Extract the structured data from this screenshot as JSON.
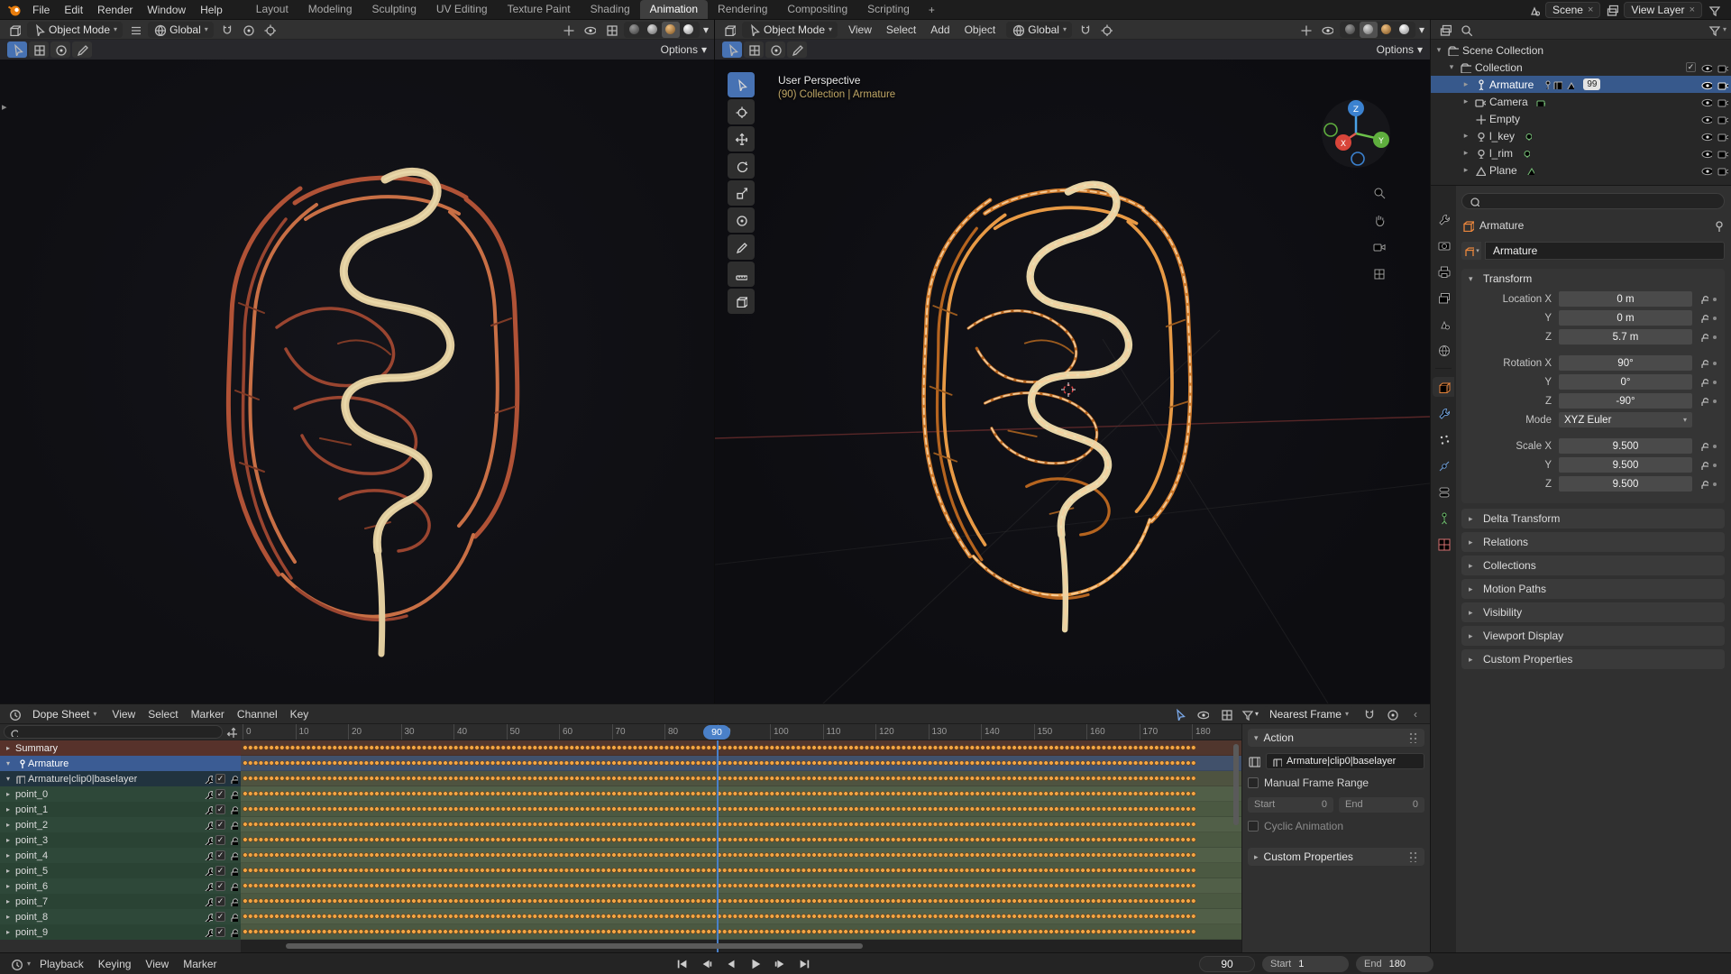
{
  "icons": {
    "blender-logo": "orange-blender-mark",
    "search": "magnifier",
    "filter": "funnel",
    "snap": "magnet",
    "eye": "visibility-eye",
    "camera": "render-camera",
    "lock": "padlock",
    "checkbox": "check-box",
    "chevron": "chevron-down",
    "pin": "push-pin",
    "play": "right-triangle"
  },
  "topbar": {
    "menus": [
      "File",
      "Edit",
      "Render",
      "Window",
      "Help"
    ],
    "workspaces": [
      {
        "label": "Layout"
      },
      {
        "label": "Modeling"
      },
      {
        "label": "Sculpting"
      },
      {
        "label": "UV Editing"
      },
      {
        "label": "Texture Paint"
      },
      {
        "label": "Shading"
      },
      {
        "label": "Animation",
        "selected": true
      },
      {
        "label": "Rendering"
      },
      {
        "label": "Compositing"
      },
      {
        "label": "Scripting"
      }
    ],
    "add_workspace_label": "+",
    "scene_name": "Scene",
    "view_layer_name": "View Layer"
  },
  "viewport_left": {
    "mode": "Object Mode",
    "orientation": "Global",
    "options_label": "Options"
  },
  "viewport_right": {
    "mode": "Object Mode",
    "menus": [
      "View",
      "Select",
      "Add",
      "Object"
    ],
    "orientation": "Global",
    "options_label": "Options",
    "overlay_line1": "User Perspective",
    "overlay_line2": "(90) Collection | Armature",
    "gizmo": {
      "up": "Z",
      "left": "X",
      "right": "Y"
    },
    "tools": [
      "tweak-select",
      "cursor",
      "move",
      "rotate",
      "scale",
      "transform",
      "annotate",
      "measure",
      "add-primitive"
    ]
  },
  "outliner": {
    "root_label": "Scene Collection",
    "rows": [
      {
        "label": "Collection"
      },
      {
        "label": "Armature",
        "selected": true,
        "badge": "99"
      },
      {
        "label": "Camera"
      },
      {
        "label": "Empty"
      },
      {
        "label": "l_key"
      },
      {
        "label": "l_rim"
      },
      {
        "label": "Plane"
      }
    ]
  },
  "properties": {
    "breadcrumb": "Armature",
    "object_name": "Armature",
    "transform_title": "Transform",
    "transform_rows": [
      {
        "label": "Location X",
        "value": "0 m"
      },
      {
        "label": "Y",
        "value": "0 m"
      },
      {
        "label": "Z",
        "value": "5.7 m"
      },
      {
        "label": "Rotation X",
        "value": "90°"
      },
      {
        "label": "Y",
        "value": "0°"
      },
      {
        "label": "Z",
        "value": "-90°"
      },
      {
        "label": "Mode",
        "value": "XYZ Euler"
      },
      {
        "label": "Scale X",
        "value": "9.500"
      },
      {
        "label": "Y",
        "value": "9.500"
      },
      {
        "label": "Z",
        "value": "9.500"
      }
    ],
    "sections": [
      "Delta Transform",
      "Relations",
      "Collections",
      "Motion Paths",
      "Visibility",
      "Viewport Display",
      "Custom Properties"
    ]
  },
  "dopesheet": {
    "editor_label": "Dope Sheet",
    "menus": [
      "View",
      "Select",
      "Marker",
      "Channel",
      "Key"
    ],
    "snap_label": "Nearest Frame",
    "current_frame": "90",
    "ruler_ticks": [
      "0",
      "10",
      "20",
      "30",
      "40",
      "50",
      "60",
      "70",
      "80",
      "90",
      "100",
      "110",
      "120",
      "130",
      "140",
      "150",
      "160",
      "170",
      "180"
    ],
    "channels": [
      {
        "label": "Summary",
        "cls": "lane-summary"
      },
      {
        "label": "Armature",
        "cls": "lane-object",
        "selected": true
      },
      {
        "label": "Armature|clip0|baselayer",
        "cls": "lane-action"
      },
      {
        "label": "point_0",
        "cls": "lane-fc-a"
      },
      {
        "label": "point_1",
        "cls": "lane-fc-b"
      },
      {
        "label": "point_2",
        "cls": "lane-fc-a"
      },
      {
        "label": "point_3",
        "cls": "lane-fc-b"
      },
      {
        "label": "point_4",
        "cls": "lane-fc-a"
      },
      {
        "label": "point_5",
        "cls": "lane-fc-b"
      },
      {
        "label": "point_6",
        "cls": "lane-fc-a"
      },
      {
        "label": "point_7",
        "cls": "lane-fc-b"
      },
      {
        "label": "point_8",
        "cls": "lane-fc-a"
      },
      {
        "label": "point_9",
        "cls": "lane-fc-b"
      }
    ],
    "sidebar": {
      "panel_title": "Action",
      "action_name": "Armature|clip0|baselayer",
      "manual_frame_range_label": "Manual Frame Range",
      "start_label": "Start",
      "start_value": "0",
      "end_label": "End",
      "end_value": "0",
      "cyclic_label": "Cyclic Animation",
      "custom_properties_label": "Custom Properties"
    }
  },
  "statusbar": {
    "menus": [
      "Playback",
      "Keying",
      "View",
      "Marker"
    ],
    "transport": [
      "jump-to-start",
      "jump-to-prev-keyframe",
      "play-reverse",
      "play",
      "jump-to-next-keyframe",
      "jump-to-end"
    ],
    "frame_value": "90",
    "start_label": "Start",
    "start_value": "1",
    "end_label": "End",
    "end_value": "180"
  }
}
